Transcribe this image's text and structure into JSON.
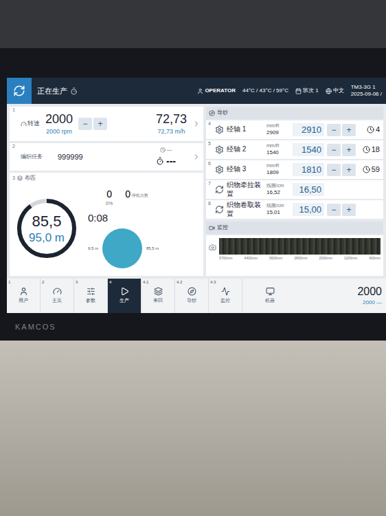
{
  "header": {
    "status": "正在生产",
    "role": "OPERATOR",
    "temps": "44°C / 43°C / 59°C",
    "shift": "班次 1",
    "language": "中文",
    "machine": "TM3-3G 1",
    "date": "2025-09-06 /"
  },
  "speed": {
    "index": "1",
    "label": "转速",
    "value": "2000",
    "setpoint": "2000 rpm",
    "minus": "−",
    "plus": "+",
    "output": "72,73",
    "output_set": "72,73 m/h"
  },
  "task": {
    "index": "2",
    "label": "编织任务",
    "value": "999999",
    "timer_value": "—",
    "remaining": "---"
  },
  "fabric": {
    "index": "3",
    "label": "布匹",
    "value": "85,5",
    "target": "95,0 m",
    "level": 0.9,
    "stops": "0",
    "stops_label": "停机次数",
    "count": "0",
    "percent": "0%",
    "time": "0:08",
    "roll_min": "9,5 m",
    "roll_max": "85,5 m"
  },
  "guide": {
    "title": "导纱",
    "rows": [
      {
        "kind": "warp",
        "index": "4",
        "name": "经轴 1",
        "unit": "mm/R",
        "actual": "2909",
        "value": "2910",
        "adjustable": true,
        "trail": "4"
      },
      {
        "kind": "warp",
        "index": "5",
        "name": "经轴 2",
        "unit": "mm/R",
        "actual": "1540",
        "value": "1540",
        "adjustable": true,
        "trail": "18"
      },
      {
        "kind": "warp",
        "index": "6",
        "name": "经轴 3",
        "unit": "mm/R",
        "actual": "1809",
        "value": "1810",
        "adjustable": true,
        "trail": "59"
      },
      {
        "kind": "fabric",
        "index": "7",
        "name": "织物牵拉装置",
        "unit": "线圈/cm",
        "actual": "16,52",
        "value": "16,50",
        "adjustable": false,
        "trail": ""
      },
      {
        "kind": "fabric",
        "index": "8",
        "name": "织物卷取装置",
        "unit": "线圈/cm",
        "actual": "15,01",
        "value": "15,00",
        "adjustable": true,
        "trail": ""
      }
    ]
  },
  "monitor": {
    "title": "监控",
    "ticks": [
      "5700mm",
      "4400mm",
      "3600mm",
      "2800mm",
      "2000mm",
      "1200mm",
      "400mm"
    ]
  },
  "nav": {
    "items": [
      {
        "index": "1",
        "label": "用户",
        "selected": false
      },
      {
        "index": "2",
        "label": "主页",
        "selected": false
      },
      {
        "index": "3",
        "label": "参数",
        "selected": false
      },
      {
        "index": "4",
        "label": "生产",
        "selected": true
      },
      {
        "index": "4.1",
        "label": "来回",
        "selected": false
      },
      {
        "index": "4.2",
        "label": "导纱",
        "selected": false
      },
      {
        "index": "4.3",
        "label": "监控",
        "selected": false
      }
    ],
    "machine": "机器"
  },
  "footer": {
    "value": "2000",
    "sub": "2000 —"
  },
  "brand": "KAMCOS"
}
